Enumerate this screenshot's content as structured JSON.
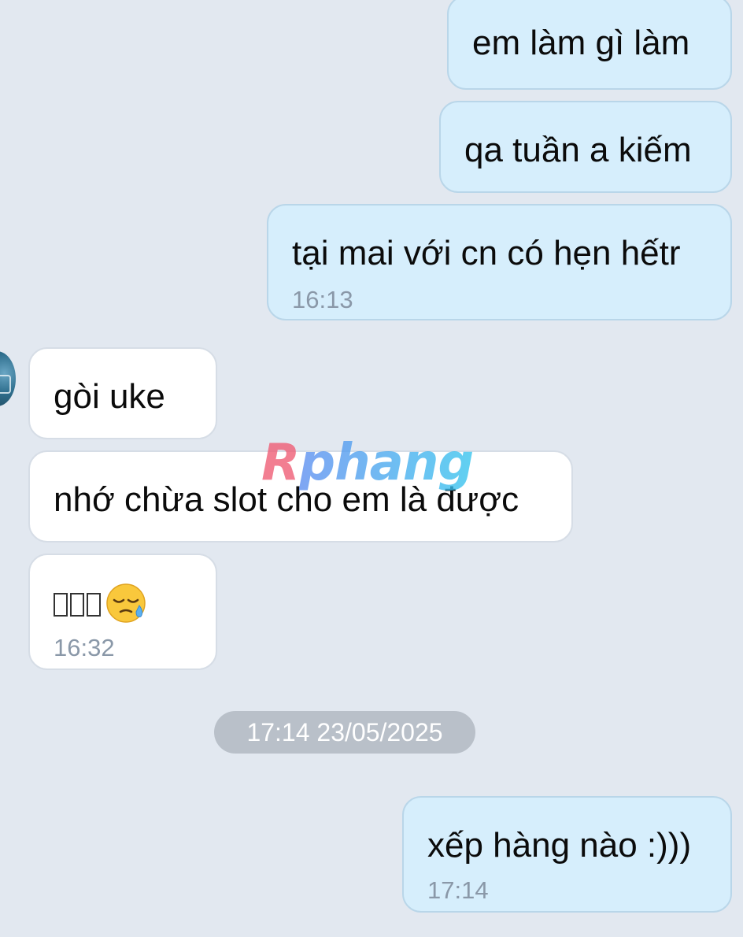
{
  "messages": [
    {
      "direction": "out",
      "text": "em làm gì làm"
    },
    {
      "direction": "out",
      "text": "qa tuần a kiếm"
    },
    {
      "direction": "out",
      "text": "tại mai với cn có hẹn hếtr",
      "time": "16:13"
    },
    {
      "direction": "in",
      "text": "gòi uke"
    },
    {
      "direction": "in",
      "text": "nhớ chừa slot cho em là được"
    },
    {
      "direction": "in",
      "text": "",
      "emoji": "sleepy-face-emoji",
      "time": "16:32"
    },
    {
      "direction": "out",
      "text": "xếp hàng nào :)))",
      "time": "17:14"
    }
  ],
  "date_separator": "17:14 23/05/2025",
  "watermark": {
    "part1": "R",
    "part2": "phang"
  },
  "colors": {
    "background": "#e2e8f0",
    "outgoing_bubble": "#d6eefc",
    "incoming_bubble": "#ffffff",
    "timestamp": "#8a98a8"
  }
}
